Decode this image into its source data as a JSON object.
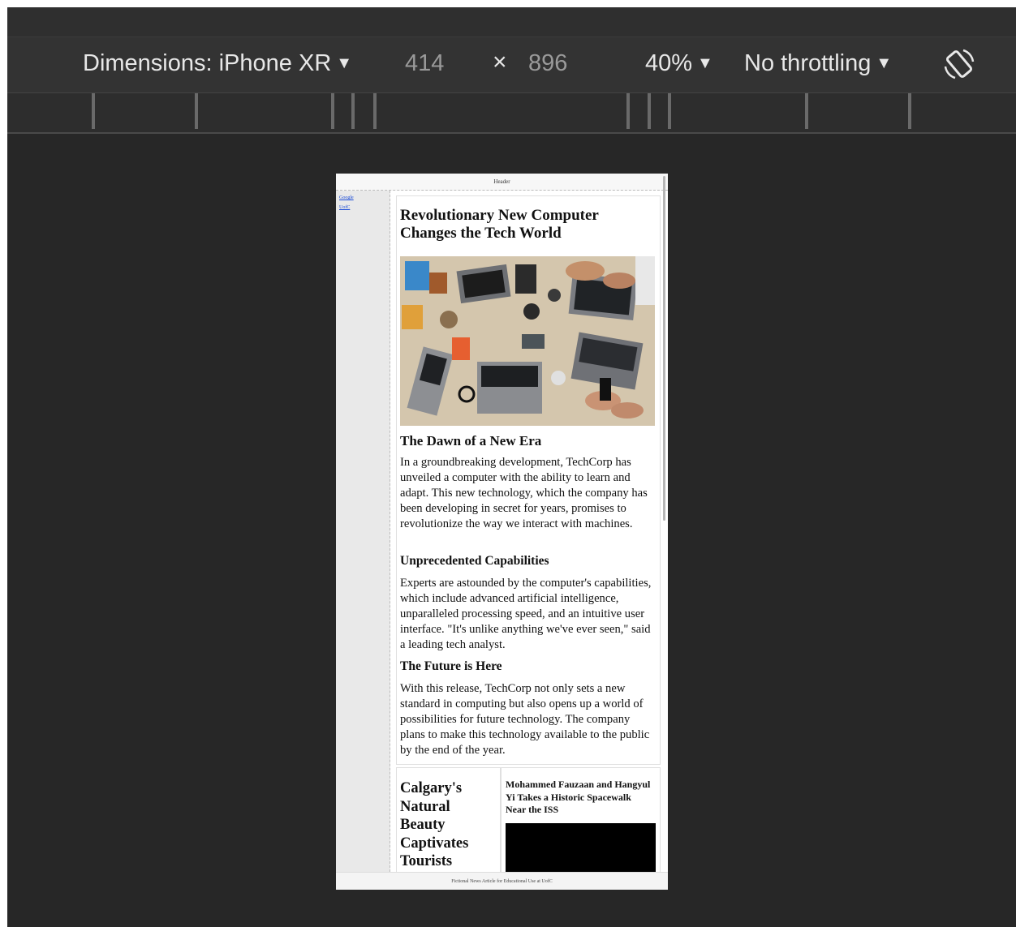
{
  "toolbar": {
    "dimensions_label": "Dimensions: iPhone XR",
    "width": "414",
    "times": "×",
    "height": "896",
    "zoom": "40%",
    "throttling": "No throttling",
    "caret": "▼"
  },
  "device_page": {
    "header": "Header",
    "sidebar_links": [
      "Google",
      "UofC"
    ],
    "article": {
      "title": "Revolutionary New Computer Changes the Tech World",
      "section1_heading": "The Dawn of a New Era",
      "section1_text": "In a groundbreaking development, TechCorp has unveiled a computer with the ability to learn and adapt. This new technology, which the company has been developing in secret for years, promises to revolutionize the way we interact with machines.",
      "section2_heading": "Unprecedented Capabilities",
      "section2_text": "Experts are astounded by the computer's capabilities, which include advanced artificial intelligence, unparalleled processing speed, and an intuitive user interface. \"It's unlike anything we've ever seen,\" said a leading tech analyst.",
      "section3_heading": "The Future is Here",
      "section3_text": "With this release, TechCorp not only sets a new standard in computing but also opens up a world of possibilities for future technology. The company plans to make this technology available to the public by the end of the year."
    },
    "card_left_title": "Calgary's Natural Beauty Captivates Tourists",
    "card_right_title": "Mohammed Fauzaan and Hangyul Yi Takes a Historic Spacewalk Near the ISS",
    "footer": "Fictional News Article for Educational Use at UofC"
  }
}
